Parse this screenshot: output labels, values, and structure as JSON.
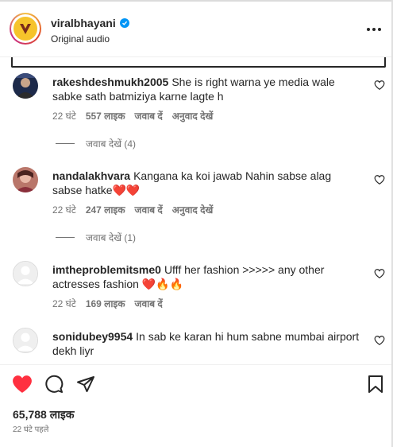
{
  "header": {
    "username": "viralbhayani",
    "subtitle": "Original audio"
  },
  "comments": [
    {
      "username": "rakeshdeshmukh2005",
      "text": "She is right warna ye media wale sabke sath batmiziya karne lagte h",
      "time": "22 घंटे",
      "likes": "557 लाइक",
      "reply": "जवाब दें",
      "translate": "अनुवाद देखें",
      "view_replies": "जवाब देखें (4)"
    },
    {
      "username": "nandalakhvara",
      "text": "Kangana ka koi jawab Nahin sabse alag sabse hatke",
      "emoji": "❤️❤️",
      "time": "22 घंटे",
      "likes": "247 लाइक",
      "reply": "जवाब दें",
      "translate": "अनुवाद देखें",
      "view_replies": "जवाब देखें (1)"
    },
    {
      "username": "imtheproblemitsme0",
      "text": "Ufff her fashion >>>>> any other actresses fashion",
      "emoji": "❤️🔥🔥",
      "time": "22 घंटे",
      "likes": "169 लाइक",
      "reply": "जवाब दें"
    },
    {
      "username": "sonidubey9954",
      "text": "In sab ke karan hi hum sabne mumbai airport dekh liyr"
    }
  ],
  "footer": {
    "likes": "65,788 लाइक",
    "time_ago": "22 घंटे पहले"
  },
  "colors": {
    "like_red": "#ff3040",
    "verified_blue": "#0095f6",
    "muted": "#737373"
  }
}
